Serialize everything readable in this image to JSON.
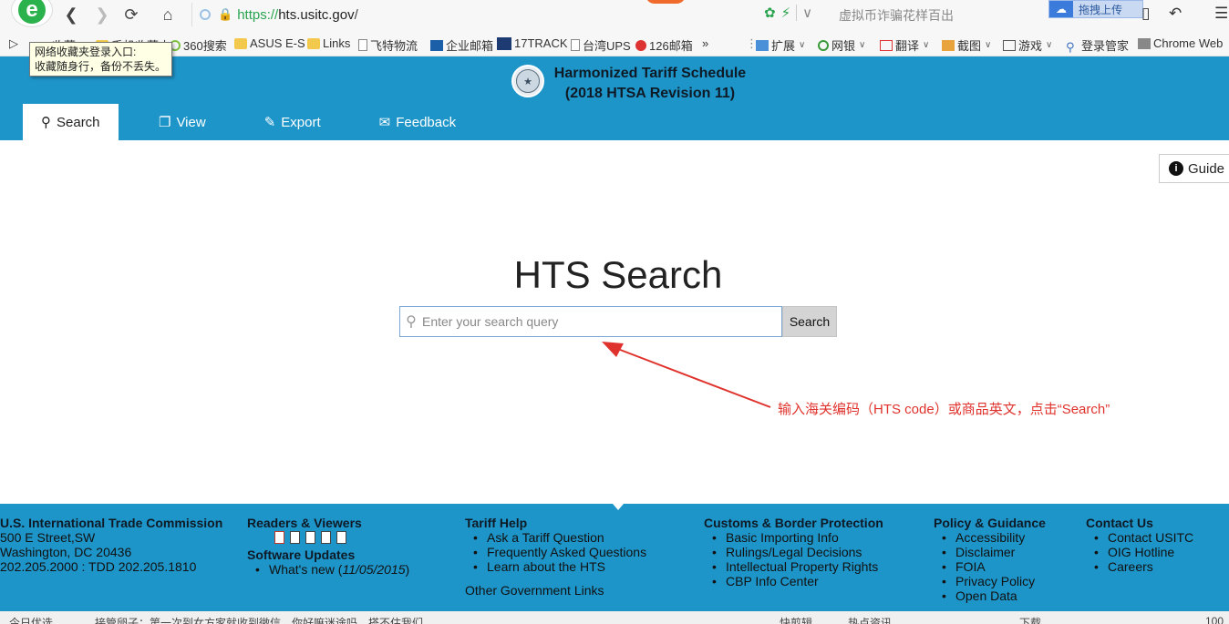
{
  "browser": {
    "url_scheme": "https://",
    "url_host": "hts.usitc.gov",
    "url_rest": "/",
    "hot_news": "虚拟币诈骗花样百出",
    "upload_label": "拖拽上传",
    "icons": {
      "back": "back-arrow-icon",
      "forward": "forward-arrow-icon",
      "reload": "reload-icon",
      "home": "home-icon"
    }
  },
  "bookmarks": {
    "items": [
      {
        "label": "收藏",
        "icon": "star-icon"
      },
      {
        "label": "手机收藏夹",
        "icon": "folder-icon"
      },
      {
        "label": "360搜索",
        "icon": "search-360-icon"
      },
      {
        "label": "ASUS E-S",
        "icon": "folder-icon"
      },
      {
        "label": "Links",
        "icon": "folder-icon"
      },
      {
        "label": "飞特物流",
        "icon": "doc-icon"
      },
      {
        "label": "企业邮箱",
        "icon": "mail-icon"
      },
      {
        "label": "17TRACK",
        "icon": "track-icon"
      },
      {
        "label": "台湾UPS",
        "icon": "doc-icon"
      },
      {
        "label": "126邮箱",
        "icon": "mail-icon"
      }
    ],
    "more": "»",
    "tools": [
      {
        "label": "扩展"
      },
      {
        "label": "网银"
      },
      {
        "label": "翻译"
      },
      {
        "label": "截图"
      },
      {
        "label": "游戏"
      },
      {
        "label": "登录管家"
      },
      {
        "label": "Chrome Web"
      }
    ],
    "tooltip_line1": "网络收藏夹登录入口:",
    "tooltip_line2": "收藏随身行，备份不丢失。"
  },
  "header": {
    "title_line1": "Harmonized Tariff Schedule",
    "title_line2": "(2018 HTSA Revision 11)",
    "tabs": [
      {
        "label": "Search",
        "icon": "search-icon",
        "active": true
      },
      {
        "label": "View",
        "icon": "copy-icon"
      },
      {
        "label": "Export",
        "icon": "export-icon"
      },
      {
        "label": "Feedback",
        "icon": "comments-icon"
      }
    ]
  },
  "main": {
    "guide_label": "Guide",
    "heading": "HTS Search",
    "search_placeholder": "Enter your search query",
    "search_value": "",
    "search_button": "Search",
    "annotation": "输入海关编码（HTS code）或商品英文，点击“Search”",
    "annotation_color": "#e0322c"
  },
  "footer": {
    "col1": {
      "title": "U.S. International Trade Commission",
      "line1": "500 E Street,SW",
      "line2": "Washington, DC 20436",
      "line3": "202.205.2000 : TDD 202.205.1810"
    },
    "col2": {
      "title": "Readers & Viewers",
      "updates_title": "Software Updates",
      "whats_new": "What's new (",
      "whats_new_date": "11/05/2015",
      "whats_new_close": ")"
    },
    "col3": {
      "title": "Tariff Help",
      "items": [
        "Ask a Tariff Question",
        "Frequently Asked Questions",
        "Learn about the HTS"
      ],
      "other": "Other Government Links"
    },
    "col4": {
      "title": "Customs & Border Protection",
      "items": [
        "Basic Importing Info",
        "Rulings/Legal Decisions",
        "Intellectual Property Rights",
        "CBP Info Center"
      ]
    },
    "col5": {
      "title": "Policy & Guidance",
      "items": [
        "Accessibility",
        "Disclaimer",
        "FOIA",
        "Privacy Policy",
        "Open Data"
      ]
    },
    "col6": {
      "title": "Contact Us",
      "items": [
        "Contact USITC",
        "OIG Hotline",
        "Careers"
      ]
    }
  },
  "statusbar": {
    "left": "今日优选",
    "ticker": "接管卵子：第一次到女方家就收到微信，你好嘛迷途吗，搭不住我们",
    "right1": "快剪辑",
    "right2": "热点资讯",
    "right3": "下载",
    "zoom": "100"
  },
  "colors": {
    "brand_blue": "#1e95c9",
    "link_green": "#2aa44f"
  }
}
